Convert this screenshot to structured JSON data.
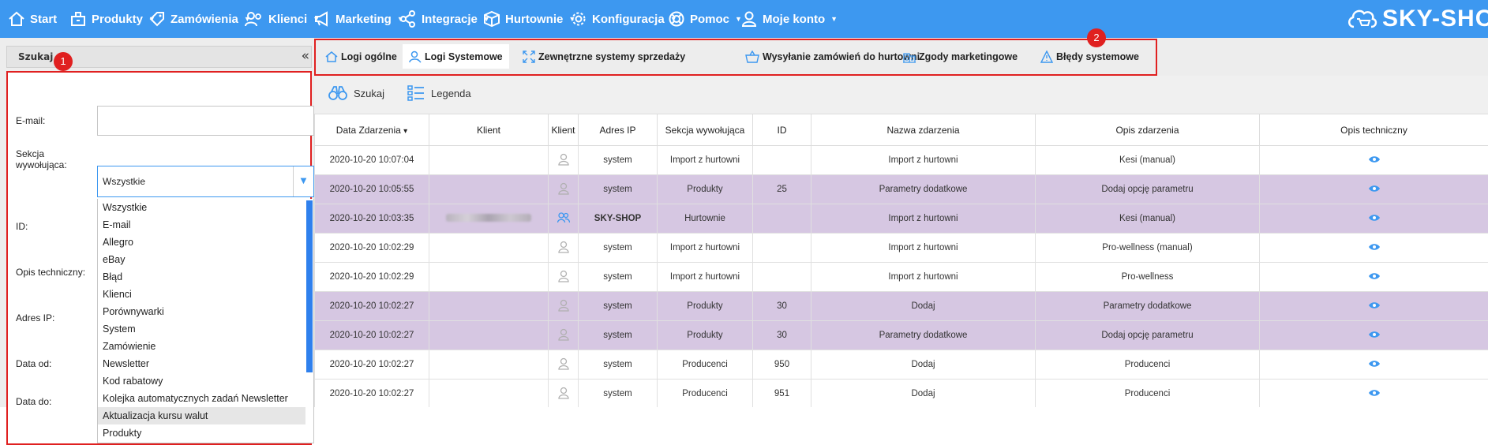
{
  "nav": {
    "items": [
      {
        "label": "Start",
        "icon": "home-icon"
      },
      {
        "label": "Produkty",
        "icon": "box-icon"
      },
      {
        "label": "Zamówienia",
        "icon": "tag-icon"
      },
      {
        "label": "Klienci",
        "icon": "users-icon"
      },
      {
        "label": "Marketing",
        "icon": "megaphone-icon"
      },
      {
        "label": "Integracje",
        "icon": "share-icon"
      },
      {
        "label": "Hurtownie",
        "icon": "cube-icon"
      },
      {
        "label": "Konfiguracja",
        "icon": "gear-icon"
      },
      {
        "label": "Pomoc",
        "icon": "lifebuoy-icon"
      },
      {
        "label": "Moje konto",
        "icon": "user-icon"
      }
    ],
    "logo": "SKY-SHOP"
  },
  "left": {
    "title": "Szukaj",
    "collapse": "«",
    "labels": {
      "email": "E-mail:",
      "sekcja": "Sekcja wywołująca:",
      "id": "ID:",
      "opis": "Opis techniczny:",
      "adres": "Adres IP:",
      "data_od": "Data od:",
      "data_do": "Data do:"
    },
    "email_value": "",
    "select_value": "Wszystkie",
    "options": [
      "Wszystkie",
      "E-mail",
      "Allegro",
      "eBay",
      "Błąd",
      "Klienci",
      "Porównywarki",
      "System",
      "Zamówienie",
      "Newsletter",
      "Kod rabatowy",
      "Kolejka automatycznych zadań Newsletter",
      "Aktualizacja kursu walut",
      "Produkty"
    ],
    "highlighted_option": "Aktualizacja kursu walut"
  },
  "badges": {
    "one": "1",
    "two": "2"
  },
  "tabs": [
    {
      "label": "Logi ogólne",
      "icon": "home-icon",
      "active": false
    },
    {
      "label": "Logi Systemowe",
      "icon": "user-search-icon",
      "active": true
    },
    {
      "label": "Zewnętrzne systemy sprzedaży",
      "icon": "expand-icon",
      "active": false
    },
    {
      "label": "Wysyłanie zamówień do hurtowni",
      "icon": "basket-icon",
      "active": false
    },
    {
      "label": "Zgody marketingowe",
      "icon": "building-icon",
      "active": false
    },
    {
      "label": "Błędy systemowe",
      "icon": "warning-icon",
      "active": false
    }
  ],
  "toolbar": {
    "search_label": "Szukaj",
    "legend_label": "Legenda"
  },
  "table": {
    "headers": [
      "Data Zdarzenia",
      "Klient",
      "Klient",
      "Adres IP",
      "Sekcja wywołująca",
      "ID",
      "Nazwa zdarzenia",
      "Opis zdarzenia",
      "Opis techniczny"
    ],
    "sort_indicator": "▾",
    "rows": [
      {
        "date": "2020-10-20 10:07:04",
        "client": "",
        "ip": "system",
        "section": "Import z hurtowni",
        "id": "",
        "name": "Import z hurtowni",
        "desc": "Kesi (manual)",
        "purple": false,
        "blur": false,
        "active_user": false
      },
      {
        "date": "2020-10-20 10:05:55",
        "client": "",
        "ip": "system",
        "section": "Produkty",
        "id": "25",
        "name": "Parametry dodatkowe",
        "desc": "Dodaj opcję parametru",
        "purple": true,
        "blur": false,
        "active_user": false
      },
      {
        "date": "2020-10-20 10:03:35",
        "client": "",
        "ip": "SKY-SHOP",
        "section": "Hurtownie",
        "id": "",
        "name": "Import z hurtowni",
        "desc": "Kesi (manual)",
        "purple": true,
        "blur": true,
        "active_user": true
      },
      {
        "date": "2020-10-20 10:02:29",
        "client": "",
        "ip": "system",
        "section": "Import z hurtowni",
        "id": "",
        "name": "Import z hurtowni",
        "desc": "Pro-wellness (manual)",
        "purple": false,
        "blur": false,
        "active_user": false
      },
      {
        "date": "2020-10-20 10:02:29",
        "client": "",
        "ip": "system",
        "section": "Import z hurtowni",
        "id": "",
        "name": "Import z hurtowni",
        "desc": "Pro-wellness",
        "purple": false,
        "blur": false,
        "active_user": false
      },
      {
        "date": "2020-10-20 10:02:27",
        "client": "",
        "ip": "system",
        "section": "Produkty",
        "id": "30",
        "name": "Dodaj",
        "desc": "Parametry dodatkowe",
        "purple": true,
        "blur": false,
        "active_user": false
      },
      {
        "date": "2020-10-20 10:02:27",
        "client": "",
        "ip": "system",
        "section": "Produkty",
        "id": "30",
        "name": "Parametry dodatkowe",
        "desc": "Dodaj opcję parametru",
        "purple": true,
        "blur": false,
        "active_user": false
      },
      {
        "date": "2020-10-20 10:02:27",
        "client": "",
        "ip": "system",
        "section": "Producenci",
        "id": "950",
        "name": "Dodaj",
        "desc": "Producenci",
        "purple": false,
        "blur": false,
        "active_user": false
      },
      {
        "date": "2020-10-20 10:02:27",
        "client": "",
        "ip": "system",
        "section": "Producenci",
        "id": "951",
        "name": "Dodaj",
        "desc": "Producenci",
        "purple": false,
        "blur": false,
        "active_user": false
      }
    ]
  },
  "colors": {
    "nav_bg": "#3d98f0",
    "accent_red": "#e02020",
    "row_purple": "#d6c7e2"
  }
}
